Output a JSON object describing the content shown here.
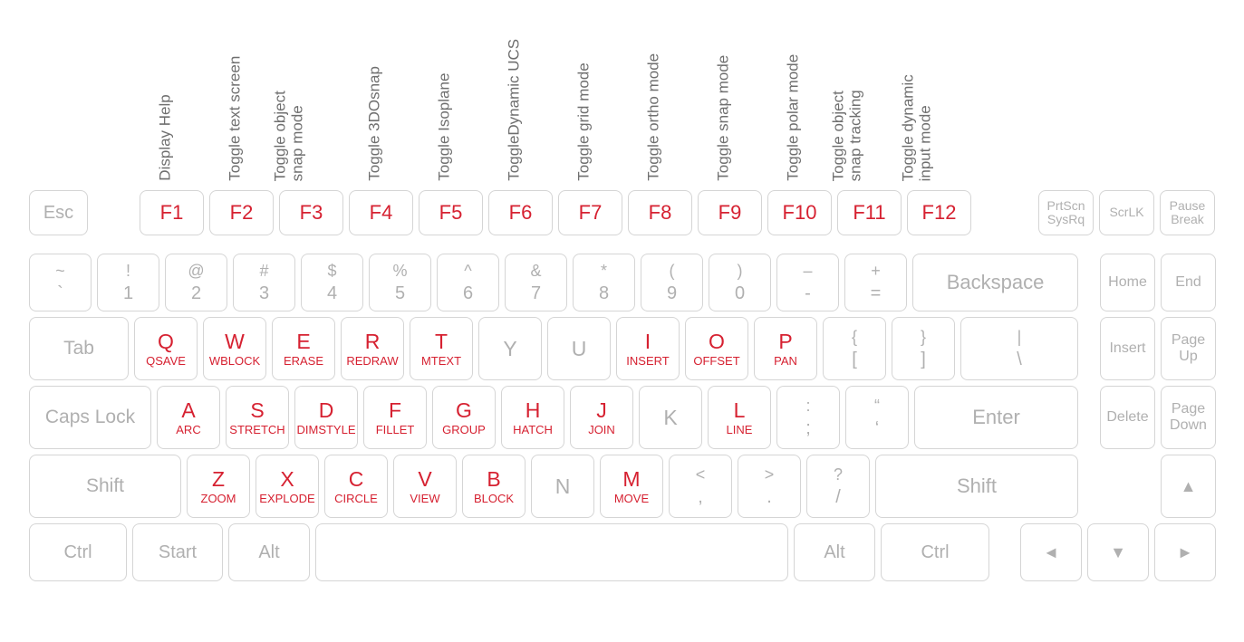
{
  "fn_labels": {
    "f1": "Display Help",
    "f2": "Toggle text screen",
    "f3_a": "Toggle object",
    "f3_b": "snap mode",
    "f4": "Toggle 3DOsnap",
    "f5": "Toggle Isoplane",
    "f6": "ToggleDynamic UCS",
    "f7": "Toggle grid mode",
    "f8": "Toggle ortho mode",
    "f9": "Toggle snap mode",
    "f10": "Toggle polar mode",
    "f11_a": "Toggle object",
    "f11_b": "snap tracking",
    "f12_a": "Toggle dynamic",
    "f12_b": "input mode"
  },
  "keys": {
    "esc": "Esc",
    "f1": "F1",
    "f2": "F2",
    "f3": "F3",
    "f4": "F4",
    "f5": "F5",
    "f6": "F6",
    "f7": "F7",
    "f8": "F8",
    "f9": "F9",
    "f10": "F10",
    "f11": "F11",
    "f12": "F12",
    "prtscn_a": "PrtScn",
    "prtscn_b": "SysRq",
    "scrlk": "ScrLK",
    "pause_a": "Pause",
    "pause_b": "Break",
    "tilde_t": "~",
    "tilde_b": "`",
    "n1_t": "!",
    "n1_b": "1",
    "n2_t": "@",
    "n2_b": "2",
    "n3_t": "#",
    "n3_b": "3",
    "n4_t": "$",
    "n4_b": "4",
    "n5_t": "%",
    "n5_b": "5",
    "n6_t": "^",
    "n6_b": "6",
    "n7_t": "&",
    "n7_b": "7",
    "n8_t": "*",
    "n8_b": "8",
    "n9_t": "(",
    "n9_b": "9",
    "n0_t": ")",
    "n0_b": "0",
    "minus_t": "–",
    "minus_b": "-",
    "plus_t": "+",
    "plus_b": "=",
    "backspace": "Backspace",
    "home": "Home",
    "end": "End",
    "tab": "Tab",
    "q": "Q",
    "q_cmd": "QSAVE",
    "w": "W",
    "w_cmd": "WBLOCK",
    "e": "E",
    "e_cmd": "ERASE",
    "r": "R",
    "r_cmd": "REDRAW",
    "t": "T",
    "t_cmd": "MTEXT",
    "y": "Y",
    "u": "U",
    "i": "I",
    "i_cmd": "INSERT",
    "o": "O",
    "o_cmd": "OFFSET",
    "p": "P",
    "p_cmd": "PAN",
    "lb_t": "{",
    "lb_b": "[",
    "rb_t": "}",
    "rb_b": "]",
    "bs_t": "|",
    "bs_b": "\\",
    "insert": "Insert",
    "pgup_a": "Page",
    "pgup_b": "Up",
    "caps": "Caps Lock",
    "a": "A",
    "a_cmd": "ARC",
    "s": "S",
    "s_cmd": "STRETCH",
    "d": "D",
    "d_cmd": "DIMSTYLE",
    "f": "F",
    "f_cmd": "FILLET",
    "g": "G",
    "g_cmd": "GROUP",
    "h": "H",
    "h_cmd": "HATCH",
    "j": "J",
    "j_cmd": "JOIN",
    "k": "K",
    "l": "L",
    "l_cmd": "LINE",
    "semi_t": ":",
    "semi_b": ";",
    "quote_t": "“",
    "quote_b": "‘",
    "enter": "Enter",
    "delete": "Delete",
    "pgdn_a": "Page",
    "pgdn_b": "Down",
    "shift": "Shift",
    "z": "Z",
    "z_cmd": "ZOOM",
    "x": "X",
    "x_cmd": "EXPLODE",
    "c": "C",
    "c_cmd": "CIRCLE",
    "v": "V",
    "v_cmd": "VIEW",
    "b": "B",
    "b_cmd": "BLOCK",
    "n": "N",
    "m": "M",
    "m_cmd": "MOVE",
    "comma_t": "<",
    "comma_b": ",",
    "dot_t": ">",
    "dot_b": ".",
    "slash_t": "?",
    "slash_b": "/",
    "ctrl": "Ctrl",
    "start": "Start",
    "alt": "Alt",
    "up": "▲",
    "down": "▼",
    "left": "◄",
    "right": "►"
  }
}
